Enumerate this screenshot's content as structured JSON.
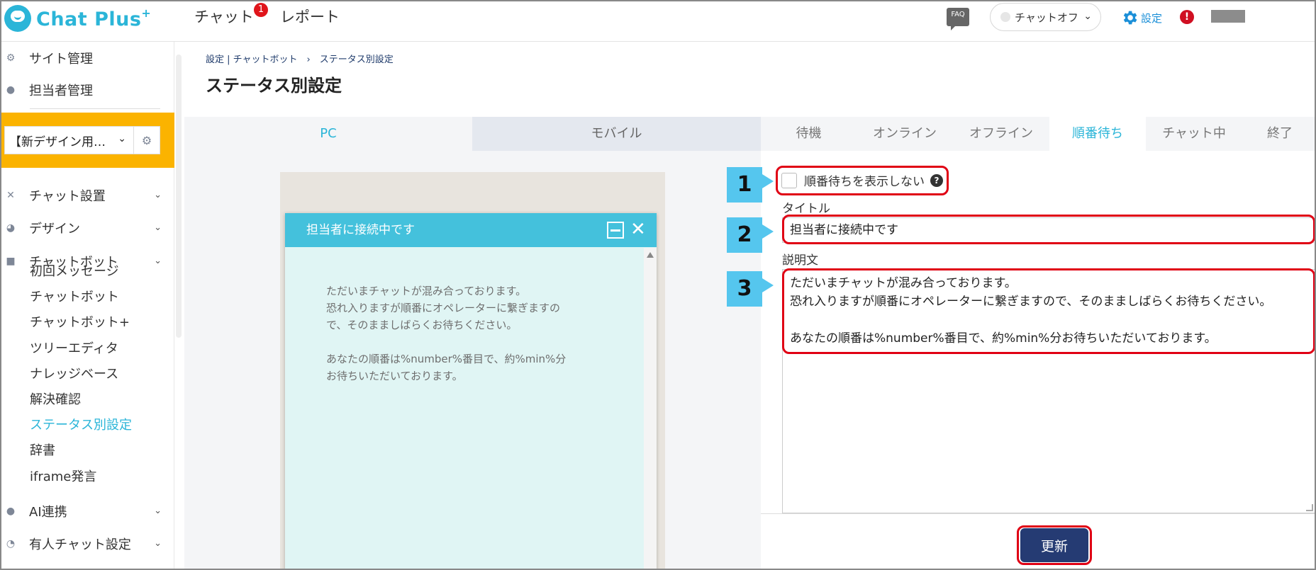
{
  "topbar": {
    "brand": "Chat Plus",
    "brand_plus": "+",
    "nav": {
      "chat": "チャット",
      "chat_badge": "1",
      "report": "レポート"
    },
    "faq": "FAQ",
    "chat_status": "チャットオフ",
    "settings": "設定",
    "alert": "!"
  },
  "sidebar": {
    "items_top": [
      {
        "label": "サイト管理",
        "icon": "gear-icon"
      },
      {
        "label": "担当者管理",
        "icon": "users-icon"
      }
    ],
    "site_select": "【新デザイン用…",
    "sections": [
      {
        "label": "チャット設置",
        "icon": "tools-icon"
      },
      {
        "label": "デザイン",
        "icon": "palette-icon"
      },
      {
        "label": "チャットボット",
        "icon": "chat-icon"
      }
    ],
    "chatbot_sub": [
      "初回メッセージ",
      "チャットボット",
      "チャットボット+",
      "ツリーエディタ",
      "ナレッジベース",
      "解決確認",
      "ステータス別設定",
      "辞書",
      "iframe発言"
    ],
    "sections_bottom": [
      {
        "label": "AI連携",
        "icon": "brain-icon"
      },
      {
        "label": "有人チャット設定",
        "icon": "headset-icon"
      }
    ]
  },
  "header": {
    "breadcrumb": "設定 | チャットボット　›　ステータス別設定",
    "title": "ステータス別設定"
  },
  "device_tabs": {
    "pc": "PC",
    "mobile": "モバイル"
  },
  "preview": {
    "title": "担当者に接続中です",
    "lines": [
      "ただいまチャットが混み合っております。",
      "恐れ入りますが順番にオペレーターに繋ぎますの",
      "で、そのまましばらくお待ちください。",
      "",
      "あなたの順番は%number%番目で、約%min%分",
      "お待ちいただいております。"
    ]
  },
  "status_tabs": [
    "待機",
    "オンライン",
    "オフライン",
    "順番待ち",
    "チャット中",
    "終了"
  ],
  "active_status_tab": 3,
  "form": {
    "markers": [
      "1",
      "2",
      "3"
    ],
    "hide_label": "順番待ちを表示しない",
    "hide_checked": false,
    "title_label": "タイトル",
    "title_value": "担当者に接続中です",
    "desc_label": "説明文",
    "desc_lines": [
      "ただいまチャットが混み合っております。",
      "恐れ入りますが順番にオペレーターに繋ぎますので、そのまましばらくお待ちください。",
      "",
      "あなたの順番は%number%番目で、約%min%分お待ちいただいております。"
    ],
    "update_label": "更新"
  },
  "colors": {
    "accent": "#2bb5d8",
    "chat_header": "#44c1dc",
    "chat_body": "#e0f5f4",
    "site_box": "#fbb300",
    "highlight": "#e00014",
    "marker": "#55c6ee",
    "update_button": "#253b73"
  }
}
